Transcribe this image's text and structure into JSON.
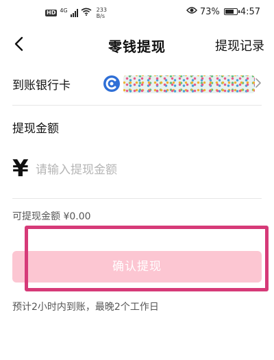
{
  "status_bar": {
    "hd": "HD",
    "network": "4G",
    "speed_value": "233",
    "speed_unit": "B/s",
    "battery": "73%",
    "time": "4:57",
    "icons": [
      "hd-icon",
      "signal-icon",
      "wifi-icon",
      "eye-icon",
      "battery-icon"
    ]
  },
  "nav": {
    "title": "零钱提现",
    "history": "提现记录",
    "back_icon": "chevron-left-icon"
  },
  "bank": {
    "label": "到账银行卡",
    "icon": "bank-logo-icon",
    "chevron_icon": "chevron-right-icon"
  },
  "amount": {
    "title": "提现金额",
    "currency_symbol": "¥",
    "placeholder": "请输入提现金额",
    "value": ""
  },
  "available_text": "可提现金额 ¥0.00",
  "confirm_label": "确认提现",
  "eta_text": "预计2小时内到账，最晚2个工作日",
  "colors": {
    "confirm_bg": "#fcc6d2",
    "highlight": "#d63a78",
    "bank_logo": "#2f6fd6"
  }
}
